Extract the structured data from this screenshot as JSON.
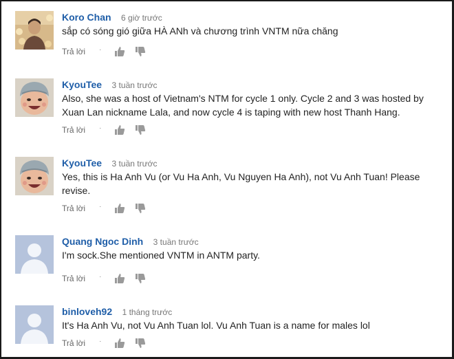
{
  "comments": [
    {
      "author": "Koro Chan",
      "time": "6 giờ trước",
      "lines": [
        "sắp có sóng gió giữa HÀ ANh và chương trình VNTM nữa chăng"
      ],
      "avatar": "photo-person-icon"
    },
    {
      "author": "KyouTee",
      "time": "3 tuần trước",
      "lines": [
        "Also, she was a host of Vietnam's NTM for cycle 1 only. Cycle 2 and 3 was hosted by",
        "Xuan Lan nickname Lala, and now cycle 4 is taping with new host Thanh Hang."
      ],
      "avatar": "baby-photo-icon"
    },
    {
      "author": "KyouTee",
      "time": "3 tuần trước",
      "lines": [
        "Yes, this is Ha Anh Vu (or Vu Ha Anh, Vu Nguyen Ha Anh), not Vu Anh Tuan! Please",
        "revise."
      ],
      "avatar": "baby-photo-icon"
    },
    {
      "author": "Quang Ngoc Dinh",
      "time": "3 tuần trước",
      "lines": [
        "I'm sock.She mentioned VNTM in ANTM party."
      ],
      "avatar": "default-user-icon"
    },
    {
      "author": "binloveh92",
      "time": "1 tháng trước",
      "lines": [
        "It's Ha Anh Vu, not Vu Anh Tuan lol. Vu Anh Tuan is a name for males lol"
      ],
      "avatar": "default-user-icon"
    }
  ],
  "actions": {
    "reply_label": "Trả lời",
    "separator": "·",
    "like_icon": "thumb-up-icon",
    "dislike_icon": "thumb-down-icon"
  },
  "colors": {
    "author": "#1f5ea8",
    "time": "#767676",
    "text": "#222222",
    "reply": "#666666",
    "thumb": "#9a9a9a",
    "default_avatar_bg": "#b5c3dc",
    "default_avatar_fg": "#f2f5fa"
  }
}
